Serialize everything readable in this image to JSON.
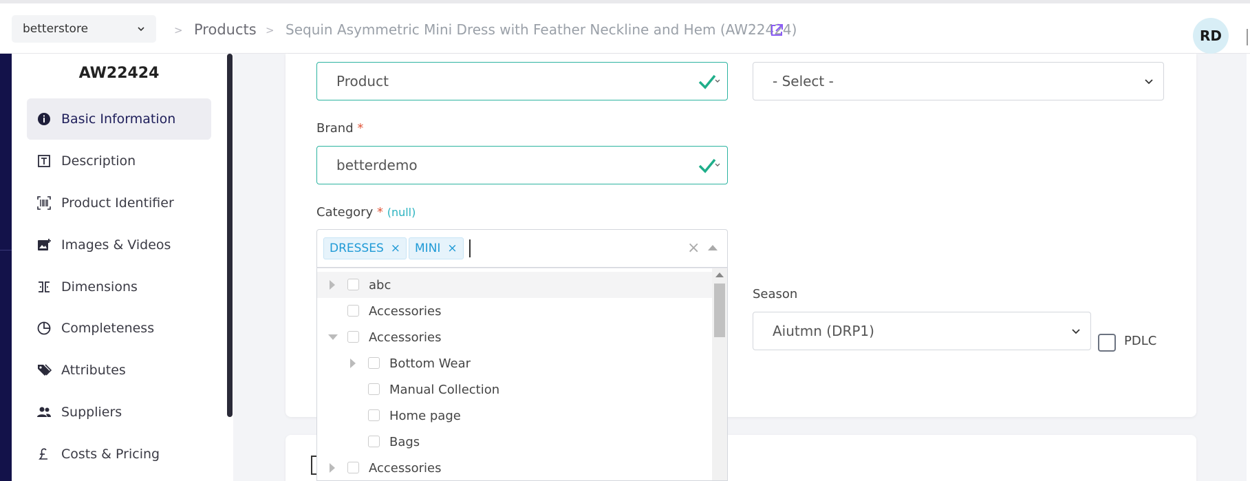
{
  "header": {
    "store": "betterstore",
    "breadcrumb_products": "Products",
    "breadcrumb_product": "Sequin Asymmetric Mini Dress with Feather Neckline and Hem (AW22424)",
    "avatar": "RD"
  },
  "sidebar": {
    "title": "AW22424",
    "items": [
      {
        "label": "Basic Information",
        "icon": "info-icon",
        "active": true
      },
      {
        "label": "Description",
        "icon": "text-box-icon"
      },
      {
        "label": "Product Identifier",
        "icon": "barcode-icon"
      },
      {
        "label": "Images & Videos",
        "icon": "image-icon"
      },
      {
        "label": "Dimensions",
        "icon": "dimensions-icon"
      },
      {
        "label": "Completeness",
        "icon": "pie-chart-icon"
      },
      {
        "label": "Attributes",
        "icon": "tags-icon"
      },
      {
        "label": "Suppliers",
        "icon": "people-icon"
      },
      {
        "label": "Costs & Pricing",
        "icon": "pound-icon"
      }
    ]
  },
  "form": {
    "type_value": "Product",
    "type_select_placeholder": "- Select -",
    "brand_label": "Brand",
    "brand_value": "betterdemo",
    "required_mark": "*",
    "category_label": "Category",
    "category_null": "(null)",
    "category_chips": [
      "DRESSES",
      "MINI"
    ],
    "chip_remove": "×",
    "clear_symbol": "×",
    "season_label": "Season",
    "season_value": "Aiutmn (DRP1)",
    "pdlc_label": "PDLC"
  },
  "category_tree": [
    {
      "label": "abc",
      "expander": "collapsed",
      "level": 0
    },
    {
      "label": "Accessories",
      "expander": "none",
      "level": 0
    },
    {
      "label": "Accessories",
      "expander": "expanded",
      "level": 0
    },
    {
      "label": "Bottom Wear",
      "expander": "collapsed",
      "level": 1
    },
    {
      "label": "Manual Collection",
      "expander": "none",
      "level": 1
    },
    {
      "label": "Home page",
      "expander": "none",
      "level": 1
    },
    {
      "label": "Bags",
      "expander": "none",
      "level": 1
    },
    {
      "label": "Accessories",
      "expander": "collapsed",
      "level": 0
    }
  ],
  "colors": {
    "nav_dark": "#13124a",
    "valid_border": "#2bb3a0",
    "check_green": "#1fae8a",
    "chip_text": "#1f9ad6",
    "required_red": "#e0563a",
    "link_purple": "#8b5cf6"
  }
}
